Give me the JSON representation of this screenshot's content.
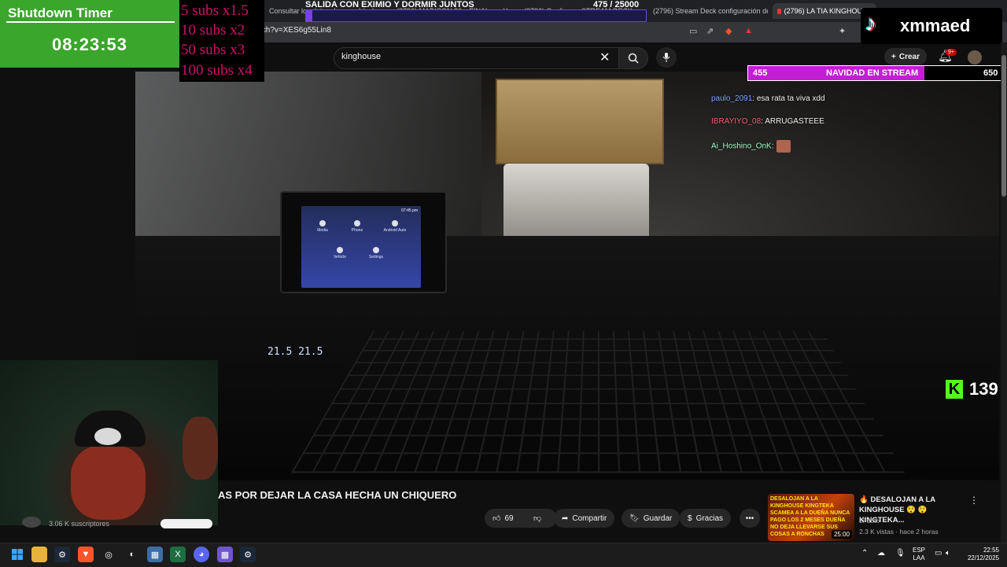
{
  "browser": {
    "tabs": [
      "Consultar los datos de un vehículo",
      "(2796) MADISON 80 y FINAL ... - YouTube",
      "(2796) Configurar STREAM DECK pa...",
      "(2796) Stream Deck configuración de...",
      "(2796) LA TIA KINGHOUSE"
    ],
    "url": "tch?v=XES6g55Lin8",
    "new_tab": "+"
  },
  "youtube": {
    "search_value": "kinghouse",
    "create_label": "Crear",
    "notif_badge": "9+",
    "video_title": "AS POR DEJAR LA CASA HECHA UN CHIQUERO",
    "subscribers": "3.06 K suscriptores",
    "likes": "69",
    "share_label": "Compartir",
    "save_label": "Guardar",
    "thanks_label": "Gracias",
    "more": "•••"
  },
  "recommended": {
    "thumb_text": "DESALOJAN A LA KINGHOUSE  KINGTEKA SCAMEA A LA DUEÑA NUNCA PAGO LOS 2 MESES  DUEÑA NO DEJA LLEVARSE SUS COSAS A RONCHAS",
    "duration": "25:00",
    "title": "🔥 DESALOJAN A LA KINGHOUSE 😲 😲 KINGTEKA...",
    "channel": "5Facto",
    "meta": "2.3 K vistas · hace 2 horas",
    "menu": "⋮"
  },
  "overlays": {
    "timer_title": "Shutdown Timer",
    "timer_value": "08:23:53",
    "multipliers": [
      "5 subs x1.5",
      "10 subs x2",
      "50 subs x3",
      "100 subs x4"
    ],
    "goal_title": "SALIDA CON EXIMIO Y DORMIR JUNTOS",
    "goal_count": "475   / 25000",
    "goal_current": 475,
    "goal_target": 25000,
    "tiktok_name": "xmmaed",
    "navidad_start": "455",
    "navidad_title": "NAVIDAD EN STREAM",
    "navidad_end": "650",
    "navidad_progress_fraction": 0.7,
    "chat": [
      {
        "user": "paulo_2091",
        "msg": ": esa rata ta viva xdd",
        "color": "#7aa7ff"
      },
      {
        "user": "IBRAYIYO_08",
        "msg": ": ARRUGASTEEE",
        "color": "#ff5e7a"
      },
      {
        "user": "Ai_Hoshino_OnK",
        "msg": ":",
        "color": "#9affc5"
      }
    ],
    "kick_logo": "K",
    "kick_viewers": "139"
  },
  "car_screen": {
    "apps": [
      "Media",
      "Phone",
      "Android Auto",
      "Vehicle",
      "Settings"
    ],
    "clock": "07:45 pm",
    "climate": "21.5   21.5"
  },
  "taskbar": {
    "lang_line1": "ESP",
    "lang_line2": "LAA",
    "time": "22:55",
    "date": "22/12/2025"
  },
  "colors": {
    "timer_green": "#3aa62b",
    "multiplier_pink": "#d0106a",
    "navidad_fill": "#c21ed4",
    "kick_green": "#53fc18"
  }
}
